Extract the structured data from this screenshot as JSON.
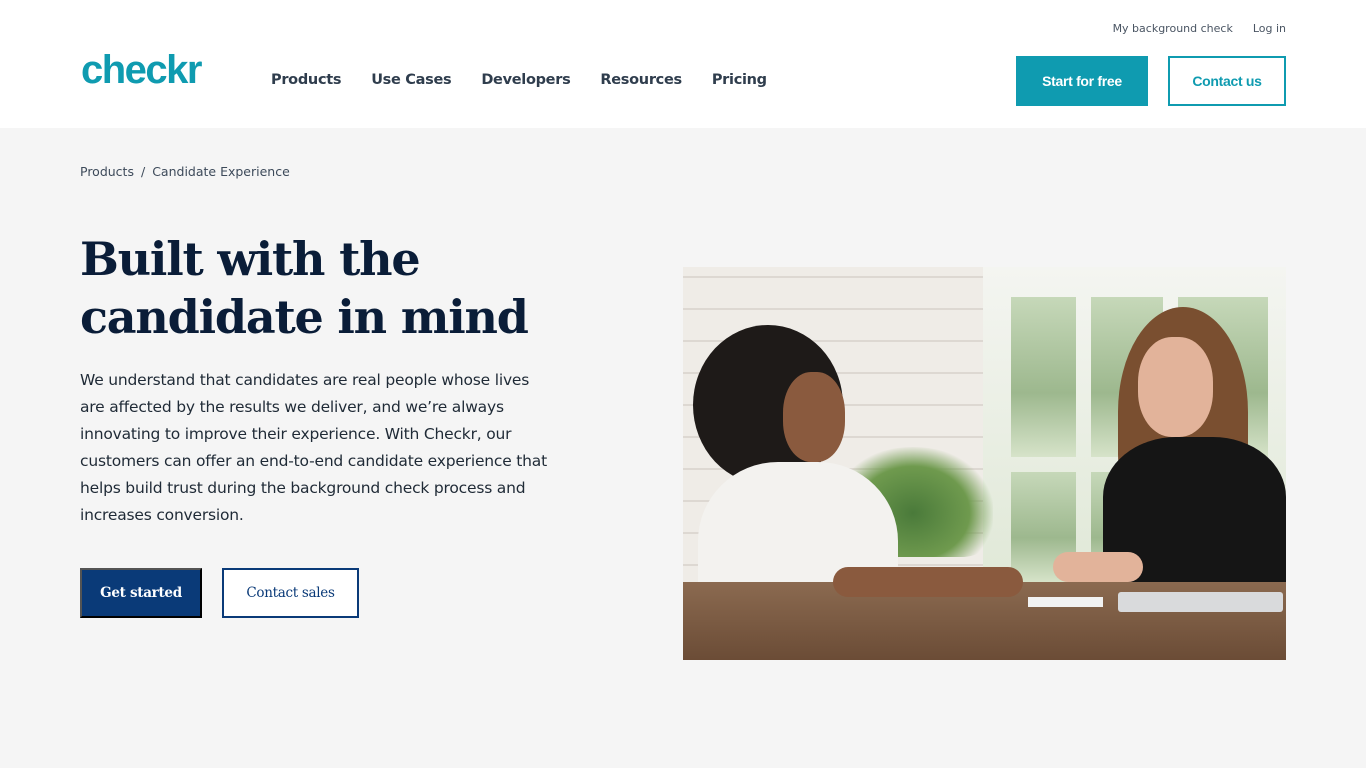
{
  "header": {
    "logo": "checkr",
    "nav": [
      "Products",
      "Use Cases",
      "Developers",
      "Resources",
      "Pricing"
    ],
    "utility_links": [
      "My background check",
      "Log in"
    ],
    "start_button": "Start for free",
    "contact_button": "Contact us"
  },
  "breadcrumb": {
    "items": [
      "Products",
      "Candidate Experience"
    ],
    "separator": "/"
  },
  "hero": {
    "title": "Built with the candidate in mind",
    "description": "We understand that candidates are real people whose lives are affected by the results we deliver, and we’re always innovating to improve their experience. With Checkr, our customers can offer an end-to-end candidate experience that helps build trust during the background check process and increases conversion.",
    "primary_button": "Get started",
    "secondary_button": "Contact sales",
    "image_alt": "Two women smiling during a conversation at a table"
  },
  "colors": {
    "brand_teal": "#0f9bb0",
    "navy": "#0a3a78",
    "heading": "#0a1d38",
    "page_bg": "#f5f5f5"
  }
}
